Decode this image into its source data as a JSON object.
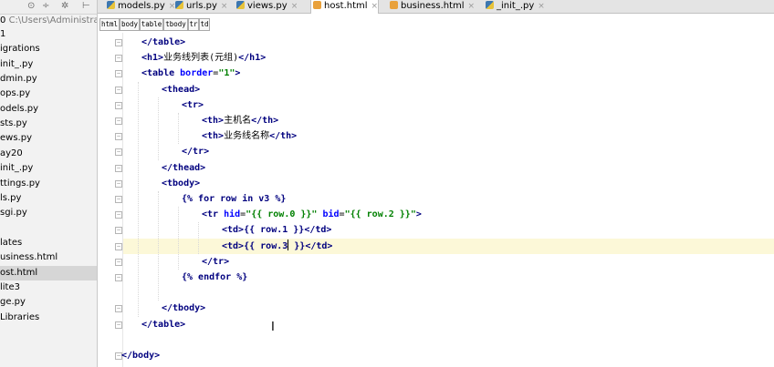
{
  "project": {
    "root_name": "0",
    "root_path": "C:\\Users\\Administrato",
    "toolbar_icons": [
      "target-icon",
      "collapse-icon",
      "settings-icon",
      "hide-icon"
    ],
    "items": [
      {
        "label": "1",
        "selected": false
      },
      {
        "label": "igrations",
        "selected": false
      },
      {
        "label": "init_.py",
        "selected": false
      },
      {
        "label": "dmin.py",
        "selected": false
      },
      {
        "label": "ops.py",
        "selected": false
      },
      {
        "label": "odels.py",
        "selected": false
      },
      {
        "label": "sts.py",
        "selected": false
      },
      {
        "label": "ews.py",
        "selected": false
      },
      {
        "label": "ay20",
        "selected": false
      },
      {
        "label": "init_.py",
        "selected": false
      },
      {
        "label": "ttings.py",
        "selected": false
      },
      {
        "label": "ls.py",
        "selected": false
      },
      {
        "label": "sgi.py",
        "selected": false
      },
      {
        "label": "",
        "selected": false
      },
      {
        "label": "lates",
        "selected": false
      },
      {
        "label": "usiness.html",
        "selected": false
      },
      {
        "label": "ost.html",
        "selected": true
      },
      {
        "label": "lite3",
        "selected": false
      },
      {
        "label": "ge.py",
        "selected": false
      },
      {
        "label": "Libraries",
        "selected": false
      }
    ]
  },
  "tabs": [
    {
      "label": "models.py",
      "type": "py",
      "active": false
    },
    {
      "label": "urls.py",
      "type": "py",
      "active": false
    },
    {
      "label": "views.py",
      "type": "py",
      "active": false
    },
    {
      "label": "host.html",
      "type": "html",
      "active": true
    },
    {
      "label": "business.html",
      "type": "html",
      "active": false
    },
    {
      "label": "_init_.py",
      "type": "py",
      "active": false
    }
  ],
  "tab_close_glyph": "×",
  "breadcrumbs": [
    "html",
    "body",
    "table",
    "tbody",
    "tr",
    "td"
  ],
  "code": {
    "current_line_index": 13,
    "lines": [
      {
        "indent": 1,
        "tokens": [
          [
            "tag",
            "</table>"
          ]
        ]
      },
      {
        "indent": 1,
        "tokens": [
          [
            "tag",
            "<h1>"
          ],
          [
            "txt",
            "业务线列表(元组)"
          ],
          [
            "tag",
            "</h1>"
          ]
        ]
      },
      {
        "indent": 1,
        "tokens": [
          [
            "tag",
            "<table "
          ],
          [
            "attr",
            "border"
          ],
          [
            "txt",
            "="
          ],
          [
            "str",
            "\"1\""
          ],
          [
            "tag",
            ">"
          ]
        ]
      },
      {
        "indent": 2,
        "tokens": [
          [
            "tag",
            "<thead>"
          ]
        ]
      },
      {
        "indent": 3,
        "tokens": [
          [
            "tag",
            "<tr>"
          ]
        ]
      },
      {
        "indent": 4,
        "tokens": [
          [
            "tag",
            "<th>"
          ],
          [
            "txt",
            "主机名"
          ],
          [
            "tag",
            "</th>"
          ]
        ]
      },
      {
        "indent": 4,
        "tokens": [
          [
            "tag",
            "<th>"
          ],
          [
            "txt",
            "业务线名称"
          ],
          [
            "tag",
            "</th>"
          ]
        ]
      },
      {
        "indent": 3,
        "tokens": [
          [
            "tag",
            "</tr>"
          ]
        ]
      },
      {
        "indent": 2,
        "tokens": [
          [
            "tag",
            "</thead>"
          ]
        ]
      },
      {
        "indent": 2,
        "tokens": [
          [
            "tag",
            "<tbody>"
          ]
        ]
      },
      {
        "indent": 3,
        "tokens": [
          [
            "tpl",
            "{% for row in v3 %}"
          ]
        ]
      },
      {
        "indent": 4,
        "tokens": [
          [
            "tag",
            "<tr "
          ],
          [
            "attr",
            "hid"
          ],
          [
            "txt",
            "="
          ],
          [
            "str",
            "\"{{ row.0 }}\" "
          ],
          [
            "attr",
            "bid"
          ],
          [
            "txt",
            "="
          ],
          [
            "str",
            "\"{{ row.2 }}\""
          ],
          [
            "tag",
            ">"
          ]
        ]
      },
      {
        "indent": 5,
        "tokens": [
          [
            "tag",
            "<td>"
          ],
          [
            "tpl",
            "{{ row.1 }}"
          ],
          [
            "tag",
            "</td>"
          ]
        ]
      },
      {
        "indent": 5,
        "tokens": [
          [
            "tag",
            "<td>"
          ],
          [
            "tpl",
            "{{ row.3"
          ],
          [
            "caret",
            ""
          ],
          [
            "tpl",
            " }}"
          ],
          [
            "tag",
            "</td>"
          ]
        ]
      },
      {
        "indent": 4,
        "tokens": [
          [
            "tag",
            "</tr>"
          ]
        ]
      },
      {
        "indent": 3,
        "tokens": [
          [
            "tpl",
            "{% endfor %}"
          ]
        ]
      },
      {
        "indent": 0,
        "tokens": []
      },
      {
        "indent": 2,
        "tokens": [
          [
            "tag",
            "</tbody>"
          ]
        ]
      },
      {
        "indent": 1,
        "tokens": [
          [
            "tag",
            "</table>"
          ]
        ]
      },
      {
        "indent": 0,
        "tokens": []
      },
      {
        "indent": 0,
        "tokens": [
          [
            "tag",
            "</body>"
          ]
        ]
      }
    ]
  },
  "colors": {
    "tag": "#00007f",
    "attribute": "#0000ff",
    "string": "#008000",
    "current_line": "#fcf8d8",
    "selected_tree_row": "#d6d6d6"
  }
}
